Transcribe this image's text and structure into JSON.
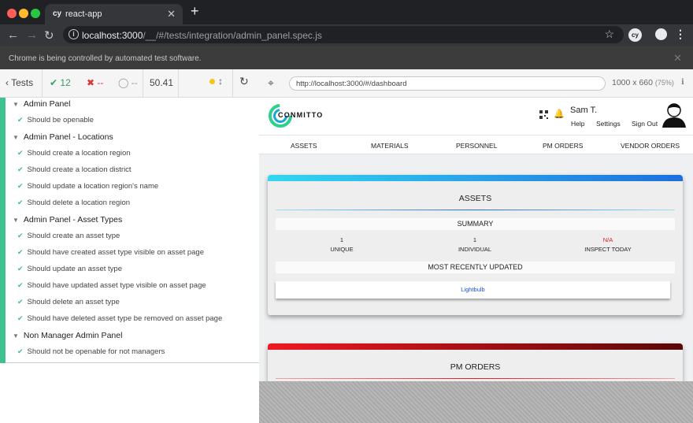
{
  "browser": {
    "tab_icon": "cy",
    "tab_title": "react-app",
    "url_host": "localhost:3000",
    "url_path": "/__/#/tests/integration/admin_panel.spec.js",
    "extension_label": "cy",
    "infobar_text": "Chrome is being controlled by automated test software.",
    "traffic_colors": [
      "#ff5f57",
      "#febc2e",
      "#28c840"
    ]
  },
  "runner": {
    "back_label": "Tests",
    "passed": "12",
    "failed": "--",
    "pending": "--",
    "duration": "50.41",
    "status_color": "#f5c518",
    "suites": [
      {
        "title": "Admin Panel",
        "tests": [
          "Should be openable"
        ]
      },
      {
        "title": "Admin Panel - Locations",
        "tests": [
          "Should create a location region",
          "Should create a location district",
          "Should update a location region's name",
          "Should delete a location region"
        ]
      },
      {
        "title": "Admin Panel - Asset Types",
        "tests": [
          "Should create an asset type",
          "Should have created asset type visible on asset page",
          "Should update an asset type",
          "Should have updated asset type visible on asset page",
          "Should delete an asset type",
          "Should have deleted asset type be removed on asset page"
        ]
      },
      {
        "title": "Non Manager Admin Panel",
        "tests": [
          "Should not be openable for not managers"
        ]
      }
    ],
    "aut_url": "http://localhost:3000/#/dashboard",
    "viewport": "1000 x 660",
    "scale": "(75%)"
  },
  "app": {
    "brand": "CONMITTO",
    "user_name": "Sam T.",
    "help_label": "Help",
    "settings_label": "Settings",
    "signout_label": "Sign Out",
    "nav": [
      "ASSETS",
      "MATERIALS",
      "PERSONNEL",
      "PM ORDERS",
      "VENDOR ORDERS"
    ],
    "assets_card": {
      "title": "ASSETS",
      "summary_label": "SUMMARY",
      "stats": [
        {
          "value": "1",
          "label": "UNIQUE"
        },
        {
          "value": "1",
          "label": "INDIVIDUAL"
        },
        {
          "value": "N/A",
          "label": "INSPECT TODAY"
        }
      ],
      "recent_label": "MOST RECENTLY UPDATED",
      "recent_item": "Lightbulb",
      "accent": "#1da1f2"
    },
    "pm_card": {
      "title": "PM ORDERS",
      "accent": "#e01b24"
    }
  }
}
